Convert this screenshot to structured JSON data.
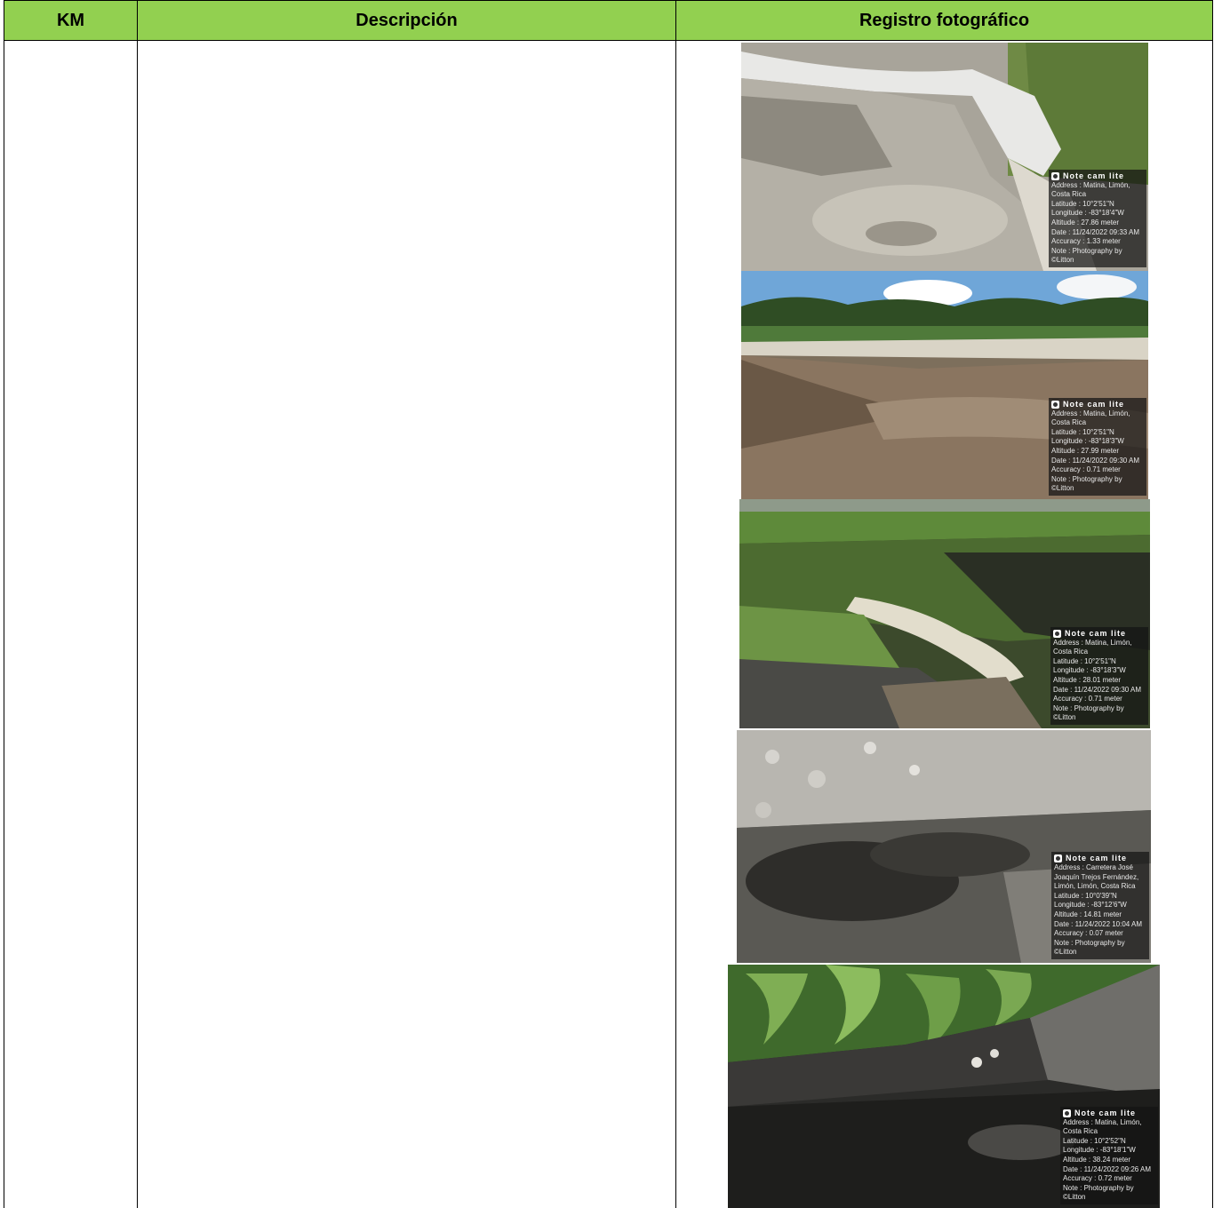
{
  "table": {
    "headers": {
      "km": "KM",
      "description": "Descripción",
      "photo": "Registro fotográfico"
    },
    "header_color": "#92d050"
  },
  "photos": [
    {
      "app": "Note cam lite",
      "address": "Address : Matina, Limón, Costa Rica",
      "latitude": "Latitude : 10°2'51\"N",
      "longitude": "Longitude : -83°18'4\"W",
      "altitude": "Altitude : 27.86 meter",
      "date": "Date : 11/24/2022 09:33 AM",
      "accuracy": "Accuracy : 1.33 meter",
      "note": "Note : Photography by ©Litton"
    },
    {
      "app": "Note cam lite",
      "address": "Address : Matina, Limón, Costa Rica",
      "latitude": "Latitude : 10°2'51\"N",
      "longitude": "Longitude : -83°18'3\"W",
      "altitude": "Altitude : 27.99 meter",
      "date": "Date : 11/24/2022 09:30 AM",
      "accuracy": "Accuracy : 0.71 meter",
      "note": "Note : Photography by ©Litton"
    },
    {
      "app": "Note cam lite",
      "address": "Address : Matina, Limón, Costa Rica",
      "latitude": "Latitude : 10°2'51\"N",
      "longitude": "Longitude : -83°18'3\"W",
      "altitude": "Altitude : 28.01 meter",
      "date": "Date : 11/24/2022 09:30 AM",
      "accuracy": "Accuracy : 0.71 meter",
      "note": "Note : Photography by ©Litton"
    },
    {
      "app": "Note cam lite",
      "address": "Address : Carretera José Joaquín Trejos Fernández, Limón, Limón, Costa Rica",
      "latitude": "Latitude : 10°0'39\"N",
      "longitude": "Longitude : -83°12'6\"W",
      "altitude": "Altitude : 14.81 meter",
      "date": "Date : 11/24/2022 10:04 AM",
      "accuracy": "Accuracy : 0.07 meter",
      "note": "Note : Photography by ©Litton"
    },
    {
      "app": "Note cam lite",
      "address": "Address : Matina, Limón, Costa Rica",
      "latitude": "Latitude : 10°2'52\"N",
      "longitude": "Longitude : -83°18'1\"W",
      "altitude": "Altitude : 38.24 meter",
      "date": "Date : 11/24/2022 09:26 AM",
      "accuracy": "Accuracy : 0.72 meter",
      "note": "Note : Photography by ©Litton"
    }
  ]
}
